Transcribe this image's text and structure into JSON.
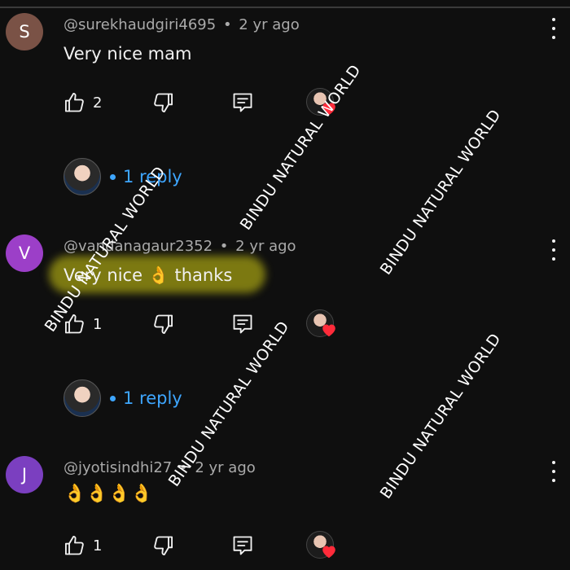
{
  "comments": [
    {
      "avatar_letter": "S",
      "avatar_color": "#7a5246",
      "handle": "@surekhaudgiri4695",
      "separator": "•",
      "time": "2 yr ago",
      "text": "Very nice mam",
      "likes": "2",
      "highlighted": false,
      "replies_label": "1 reply"
    },
    {
      "avatar_letter": "V",
      "avatar_color": "#9c3fc8",
      "handle": "@vandanagaur2352",
      "separator": "•",
      "time": "2 yr ago",
      "text": "Very nice 👌 thanks",
      "likes": "1",
      "highlighted": true,
      "replies_label": "1 reply"
    },
    {
      "avatar_letter": "J",
      "avatar_color": "#7b3fc0",
      "handle": "@jyotisindhi27",
      "separator": "•",
      "time": "2 yr ago",
      "text": "👌👌👌👌",
      "likes": "1",
      "highlighted": false,
      "replies_label": ""
    }
  ],
  "watermark": "BINDU NATURAL WORLD",
  "colors": {
    "background": "#0f0f0f",
    "link_blue": "#3ea6ff",
    "heart_red": "#ff2b3a",
    "highlight": "#d7d214"
  }
}
